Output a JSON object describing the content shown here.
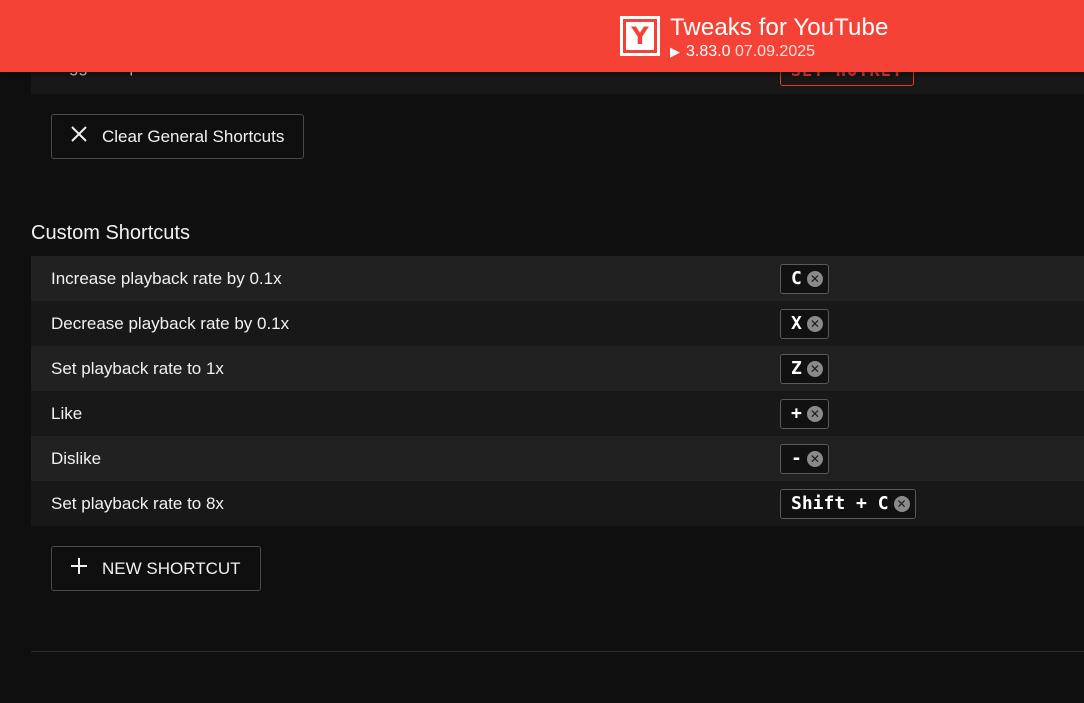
{
  "header": {
    "logo_letter": "Y",
    "title": "Tweaks for YouTube",
    "play_glyph": "▶",
    "version": "3.83.0",
    "date": "07.09.2025",
    "bg_color": "#f44336"
  },
  "general": {
    "partial_row_label": "Toggle Skip Video Intro/Outro - Individual",
    "partial_row_button": "SET HOTKEY",
    "clear_button_label": "Clear General Shortcuts",
    "clear_button_icon": "close-icon"
  },
  "custom": {
    "section_title": "Custom Shortcuts",
    "rows": [
      {
        "label": "Increase playback rate by 0.1x",
        "hotkey": "C"
      },
      {
        "label": "Decrease playback rate by 0.1x",
        "hotkey": "X"
      },
      {
        "label": "Set playback rate to 1x",
        "hotkey": "Z"
      },
      {
        "label": "Like",
        "hotkey": "+"
      },
      {
        "label": "Dislike",
        "hotkey": "-"
      },
      {
        "label": "Set playback rate to 8x",
        "hotkey": "Shift + C"
      }
    ],
    "clear_glyph": "✕",
    "new_button_label": "NEW SHORTCUT",
    "new_button_icon": "plus-icon"
  }
}
